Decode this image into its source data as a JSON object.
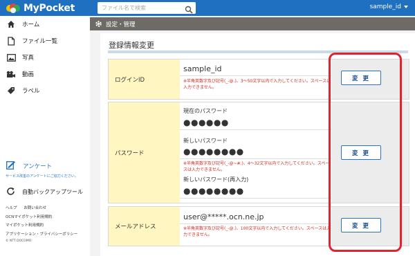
{
  "app": {
    "brand": "MyPocket",
    "search_placeholder": "ファイル名で検索",
    "user": "sample_id"
  },
  "sidebar": {
    "items": [
      {
        "label": "ホーム",
        "icon": "home-icon"
      },
      {
        "label": "ファイル一覧",
        "icon": "file-icon"
      },
      {
        "label": "写真",
        "icon": "photo-icon"
      },
      {
        "label": "動画",
        "icon": "video-icon"
      },
      {
        "label": "ラベル",
        "icon": "tag-icon"
      }
    ],
    "survey_label": "アンケート",
    "survey_note": "サービス改善のアンケートにご協力ください。",
    "backup_label": "自動バックアップツール",
    "links": {
      "help": "ヘルプ",
      "contact": "お問い合わせ",
      "ocn_terms": "OCNマイポケット利用規約",
      "terms": "マイポケット利用規約",
      "app_policy": "アプリケーション・プライバシーポリシー",
      "copyright": "© NTT DOCOMO"
    }
  },
  "main": {
    "breadcrumb": "設定・管理",
    "section_title": "登録情報変更",
    "rows": {
      "login": {
        "label": "ログインID",
        "value": "sample_id",
        "hint": "※半角英数字及び記号(_-@.)、3〜50文字以内で入力してください。スペースは入力できません。",
        "button": "変 更"
      },
      "password": {
        "label": "パスワード",
        "current_label": "現在のパスワード",
        "current_value": "●●●●●●",
        "new_label": "新しいパスワード",
        "new_value": "●●●●●●●●",
        "hint": "※半角英数字及び記号(_-@~#.)、4〜32文字以内で入力してください。スペースは入力できません。",
        "confirm_label": "新しいパスワード(再入力)",
        "confirm_value": "●●●●●●●●",
        "button": "変 更"
      },
      "email": {
        "label": "メールアドレス",
        "value": "user@*****.ocn.ne.jp",
        "hint": "※半角英数字及び記号(_-@.)、100文字以内で入力してください。スペースは入力できません。",
        "button": "変 更"
      }
    }
  },
  "colors": {
    "header": "#1f70c1",
    "breadcrumb_bg": "#6e6a66",
    "label_bg": "#fff6c1",
    "hint": "#d0281d",
    "highlight": "#e4222e"
  }
}
